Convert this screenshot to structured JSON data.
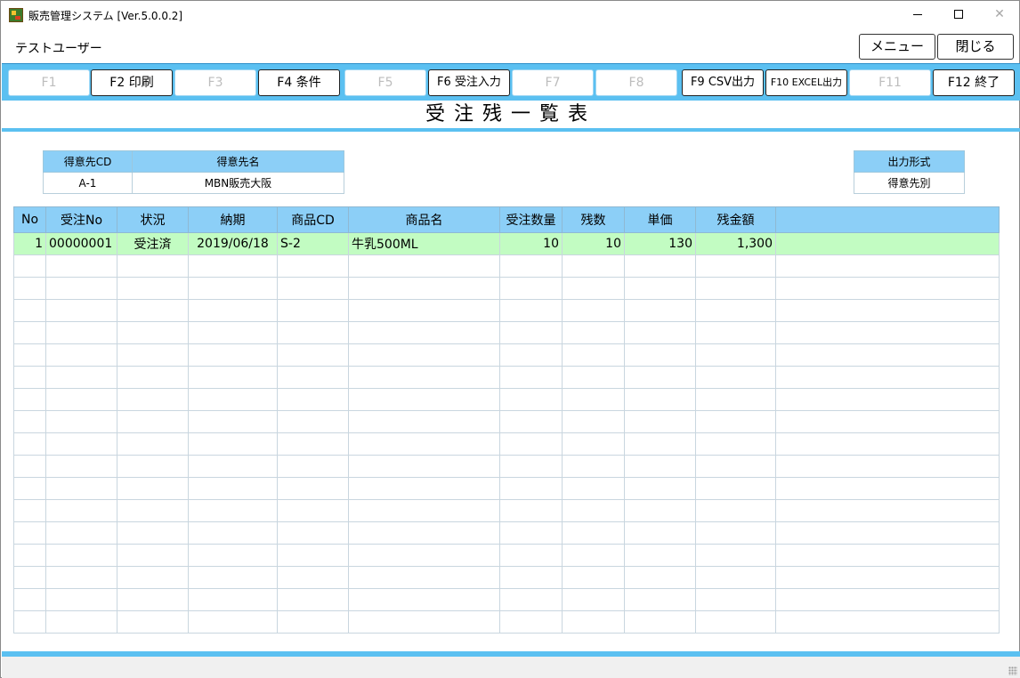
{
  "window": {
    "title": "販売管理システム [Ver.5.0.0.2]",
    "controls": {
      "minimize": "—",
      "maximize": "☐",
      "close": "✕"
    }
  },
  "user": {
    "name": "テストユーザー"
  },
  "top_buttons": {
    "menu": "メニュー",
    "close": "閉じる"
  },
  "function_keys": [
    {
      "label": "F1",
      "enabled": false
    },
    {
      "label": "F2 印刷",
      "enabled": true
    },
    {
      "label": "F3",
      "enabled": false
    },
    {
      "label": "F4 条件",
      "enabled": true
    },
    {
      "label": "F5",
      "enabled": false
    },
    {
      "label": "F6 受注入力",
      "enabled": true
    },
    {
      "label": "F7",
      "enabled": false
    },
    {
      "label": "F8",
      "enabled": false
    },
    {
      "label": "F9 CSV出力",
      "enabled": true
    },
    {
      "label": "F10 EXCEL出力",
      "enabled": true
    },
    {
      "label": "F11",
      "enabled": false
    },
    {
      "label": "F12 終了",
      "enabled": true
    }
  ],
  "page_title": "受注残一覧表",
  "customer": {
    "code_header": "得意先CD",
    "name_header": "得意先名",
    "code": "A-1",
    "name": "MBN販売大阪"
  },
  "output": {
    "header": "出力形式",
    "value": "得意先別"
  },
  "grid": {
    "columns": [
      "No",
      "受注No",
      "状況",
      "納期",
      "商品CD",
      "商品名",
      "受注数量",
      "残数",
      "単価",
      "残金額",
      ""
    ],
    "rows": [
      {
        "no": "1",
        "order_no": "00000001",
        "status": "受注済",
        "due": "2019/06/18",
        "product_cd": "S-2",
        "product_name": "牛乳500ML",
        "qty": "10",
        "remaining": "10",
        "unit_price": "130",
        "remaining_amount": "1,300"
      }
    ],
    "empty_rows": 17
  },
  "colors": {
    "accent": "#5bc0f1",
    "header_bg": "#8ccff7",
    "selected_row": "#c2fcc2"
  }
}
